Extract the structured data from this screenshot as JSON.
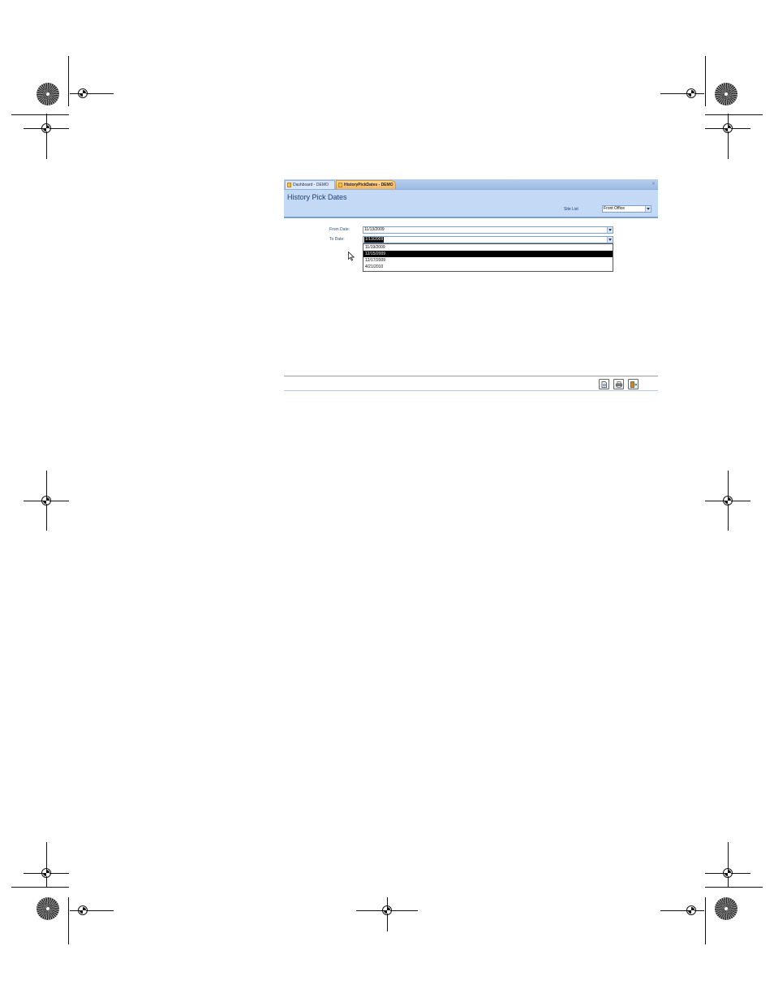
{
  "tabs": [
    {
      "label": "Dashboard - DEMO"
    },
    {
      "label": "HistoryPickDates - DEMO"
    }
  ],
  "tab_close": "×",
  "form": {
    "title": "History Pick Dates",
    "site_list_label": "Site List",
    "site_list_value": "Front Office",
    "from_date_label": "From Date:",
    "from_date_value": "11/13/2009",
    "to_date_label": "To Date:",
    "to_date_value": "1/13/2009",
    "to_date_options": [
      "11/19/2009",
      "12/15/2009",
      "12/17/2009",
      "4/21/2010"
    ],
    "to_date_selected_index": 1
  },
  "footer_buttons": [
    {
      "icon": "print-preview-icon"
    },
    {
      "icon": "printer-icon"
    },
    {
      "icon": "exit-door-icon"
    }
  ],
  "colors": {
    "header_bg": "#c3d9f6",
    "tab_active": "#f6b45a",
    "title_text": "#1e3f74"
  }
}
